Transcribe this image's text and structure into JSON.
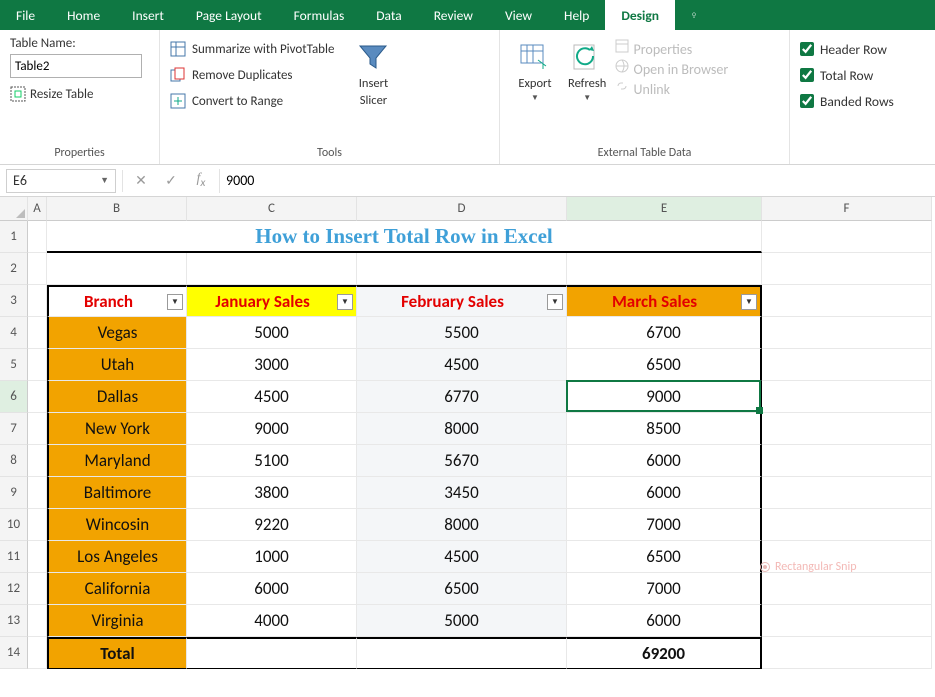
{
  "tabs": [
    "File",
    "Home",
    "Insert",
    "Page Layout",
    "Formulas",
    "Data",
    "Review",
    "View",
    "Help",
    "Design"
  ],
  "active_tab": "Design",
  "ribbon": {
    "properties": {
      "label": "Properties",
      "table_name_label": "Table Name:",
      "table_name_value": "Table2",
      "resize_label": "Resize Table"
    },
    "tools": {
      "label": "Tools",
      "pivot": "Summarize with PivotTable",
      "dup": "Remove Duplicates",
      "range": "Convert to Range",
      "slicer_top": "Insert",
      "slicer_bot": "Slicer"
    },
    "external": {
      "label": "External Table Data",
      "export": "Export",
      "refresh": "Refresh",
      "props": "Properties",
      "browser": "Open in Browser",
      "unlink": "Unlink"
    },
    "style": {
      "header": "Header Row",
      "total": "Total Row",
      "banded": "Banded Rows"
    }
  },
  "namebox": "E6",
  "formula": "9000",
  "columns": [
    "A",
    "B",
    "C",
    "D",
    "E",
    "F"
  ],
  "rows": [
    "1",
    "2",
    "3",
    "4",
    "5",
    "6",
    "7",
    "8",
    "9",
    "10",
    "11",
    "12",
    "13",
    "14"
  ],
  "title": "How to Insert Total Row in Excel",
  "headers": [
    "Branch",
    "January Sales",
    "February Sales",
    "March Sales"
  ],
  "data": [
    {
      "branch": "Vegas",
      "jan": "5000",
      "feb": "5500",
      "mar": "6700"
    },
    {
      "branch": "Utah",
      "jan": "3000",
      "feb": "4500",
      "mar": "6500"
    },
    {
      "branch": "Dallas",
      "jan": "4500",
      "feb": "6770",
      "mar": "9000"
    },
    {
      "branch": "New York",
      "jan": "9000",
      "feb": "8000",
      "mar": "8500"
    },
    {
      "branch": "Maryland",
      "jan": "5100",
      "feb": "5670",
      "mar": "6000"
    },
    {
      "branch": "Baltimore",
      "jan": "3800",
      "feb": "3450",
      "mar": "6000"
    },
    {
      "branch": "Wincosin",
      "jan": "9220",
      "feb": "8000",
      "mar": "7000"
    },
    {
      "branch": "Los Angeles",
      "jan": "1000",
      "feb": "4500",
      "mar": "6500"
    },
    {
      "branch": "California",
      "jan": "6000",
      "feb": "6500",
      "mar": "7000"
    },
    {
      "branch": "Virginia",
      "jan": "4000",
      "feb": "5000",
      "mar": "6000"
    }
  ],
  "total_label": "Total",
  "total_mar": "69200",
  "snip": "Rectangular Snip",
  "chart_data": {
    "type": "table",
    "title": "How to Insert Total Row in Excel",
    "columns": [
      "Branch",
      "January Sales",
      "February Sales",
      "March Sales"
    ],
    "rows": [
      [
        "Vegas",
        5000,
        5500,
        6700
      ],
      [
        "Utah",
        3000,
        4500,
        6500
      ],
      [
        "Dallas",
        4500,
        6770,
        9000
      ],
      [
        "New York",
        9000,
        8000,
        8500
      ],
      [
        "Maryland",
        5100,
        5670,
        6000
      ],
      [
        "Baltimore",
        3800,
        3450,
        6000
      ],
      [
        "Wincosin",
        9220,
        8000,
        7000
      ],
      [
        "Los Angeles",
        1000,
        4500,
        6500
      ],
      [
        "California",
        6000,
        6500,
        7000
      ],
      [
        "Virginia",
        4000,
        5000,
        6000
      ]
    ],
    "totals": {
      "March Sales": 69200
    }
  }
}
